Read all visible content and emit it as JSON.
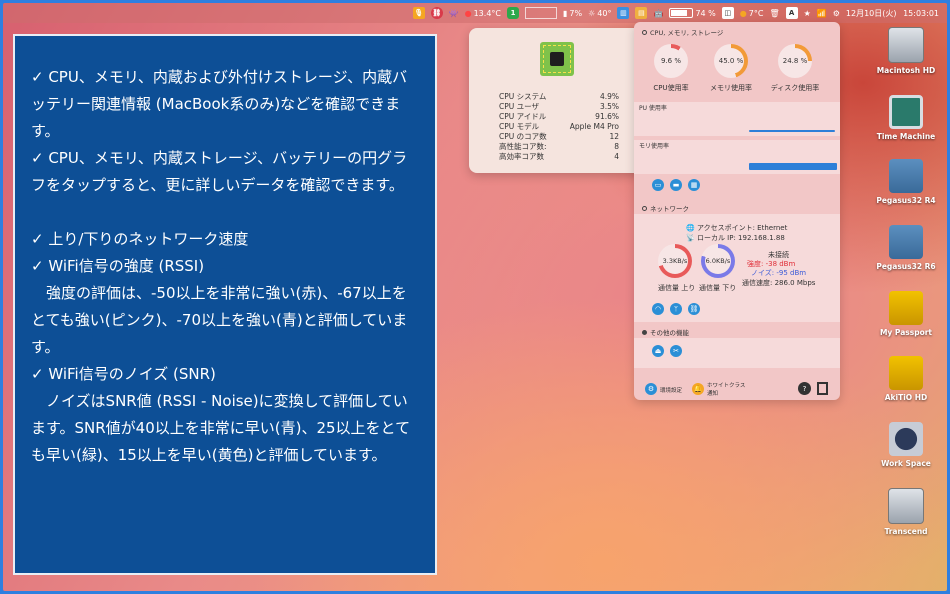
{
  "menubar": {
    "temp": "13.4°C",
    "badge": "1",
    "cpu_pct": "7%",
    "cpu_temp": "40°",
    "battery": "74 %",
    "weather": "7°C",
    "box_A": "A",
    "date": "12月10日(火)",
    "time": "15:03:01"
  },
  "panel": {
    "p1": "✓ CPU、メモリ、内蔵および外付けストレージ、内蔵バッテリー関連情報 (MacBook系のみ)などを確認できます。",
    "p2": "✓ CPU、メモリ、内蔵ストレージ、バッテリーの円グラフをタップすると、更に詳しいデータを確認できます。",
    "p3": "✓  上り/下りのネットワーク速度",
    "p4": "✓  WiFi信号の強度 (RSSI)",
    "p5": "　強度の評価は、-50以上を非常に強い(赤)、-67以上をとても強い(ピンク)、-70以上を強い(青)と評価しています。",
    "p6": "✓  WiFi信号のノイズ (SNR)",
    "p7": "　ノイズはSNR値 (RSSI - Noise)に変換して評価しています。SNR値が40以上を非常に早い(青)、25以上をとても早い(緑)、15以上を早い(黄色)と評価しています。"
  },
  "popover": {
    "rows": [
      {
        "label": "CPU システム",
        "value": "4.9%"
      },
      {
        "label": "CPU ユーザ",
        "value": "3.5%"
      },
      {
        "label": "CPU アイドル",
        "value": "91.6%"
      },
      {
        "label": "CPU モデル",
        "value": "Apple M4 Pro"
      },
      {
        "label": "CPU のコア数",
        "value": "12"
      },
      {
        "label": "高性能コア数:",
        "value": "8"
      },
      {
        "label": "高効率コア数",
        "value": "4"
      }
    ]
  },
  "widget": {
    "section1": "CPU, メモリ, ストレージ",
    "cpu_val": "9.6 %",
    "cpu_label": "CPU使用率",
    "cpu_pct": 9.6,
    "mem_val": "45.0 %",
    "mem_label": "メモリ使用率",
    "mem_pct": 45.0,
    "disk_val": "24.8 %",
    "disk_label": "ディスク使用率",
    "disk_pct": 24.8,
    "cpu_history": "PU 使用率",
    "mem_history": "モリ使用率",
    "section2": "ネットワーク",
    "ap": "アクセスポイント: Ethernet",
    "ip": "ローカル IP: 192.168.1.88",
    "up_val": "3.3KB/s",
    "up_label": "通信量 上り",
    "down_val": "6.0KB/s",
    "down_label": "通信量 下り",
    "status": "未接続",
    "rssi": "強度: -38 dBm",
    "noise": "ノイズ: -95 dBm",
    "speed": "通信速度: 286.0 Mbps",
    "section3": "その他の機能",
    "settings": "環境設定",
    "notify": "ホワイトクラス",
    "notify2": "通知",
    "help": "?"
  },
  "desktop": {
    "icons": [
      "Macintosh HD",
      "Time Machine",
      "Pegasus32 R4",
      "Pegasus32 R6",
      "My Passport",
      "AkiTiO HD",
      "Work Space",
      "Transcend"
    ]
  },
  "colors": {
    "panel_bg": "#0d4f96",
    "accent_blue": "#2d7fd8",
    "gauge_red": "#e85a5a",
    "gauge_orange": "#f29a38"
  }
}
